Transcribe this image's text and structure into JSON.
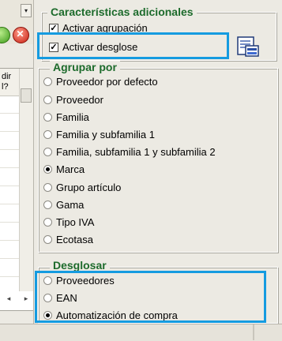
{
  "left_panel": {
    "dropdown_glyph": "▾",
    "column_header": {
      "line1": "dir",
      "line2": "l?"
    },
    "scroll_left_glyph": "◂",
    "scroll_right_glyph": "▸",
    "toolbar_icons": [
      "confirm-icon",
      "cancel-icon"
    ]
  },
  "features": {
    "title": "Características adicionales",
    "items": [
      {
        "label": "Activar agrupación",
        "checked": true
      },
      {
        "label": "Activar desglose",
        "checked": true
      }
    ],
    "config_icon": "document-config-icon"
  },
  "grouping": {
    "title": "Agrupar por",
    "options": [
      {
        "label": "Proveedor por defecto",
        "selected": false
      },
      {
        "label": "Proveedor",
        "selected": false
      },
      {
        "label": "Familia",
        "selected": false
      },
      {
        "label": "Familia y subfamilia 1",
        "selected": false
      },
      {
        "label": "Familia, subfamilia 1 y subfamilia 2",
        "selected": false
      },
      {
        "label": "Marca",
        "selected": true
      },
      {
        "label": "Grupo artículo",
        "selected": false
      },
      {
        "label": "Gama",
        "selected": false
      },
      {
        "label": "Tipo IVA",
        "selected": false
      },
      {
        "label": "Ecotasa",
        "selected": false
      }
    ]
  },
  "breakdown": {
    "title": "Desglosar",
    "options": [
      {
        "label": "Proveedores",
        "selected": false
      },
      {
        "label": "EAN",
        "selected": false
      },
      {
        "label": "Automatización de compra",
        "selected": true
      }
    ]
  },
  "colors": {
    "group_title": "#1d6b2c",
    "highlight": "#159be0",
    "panel_bg": "#eceae3"
  }
}
